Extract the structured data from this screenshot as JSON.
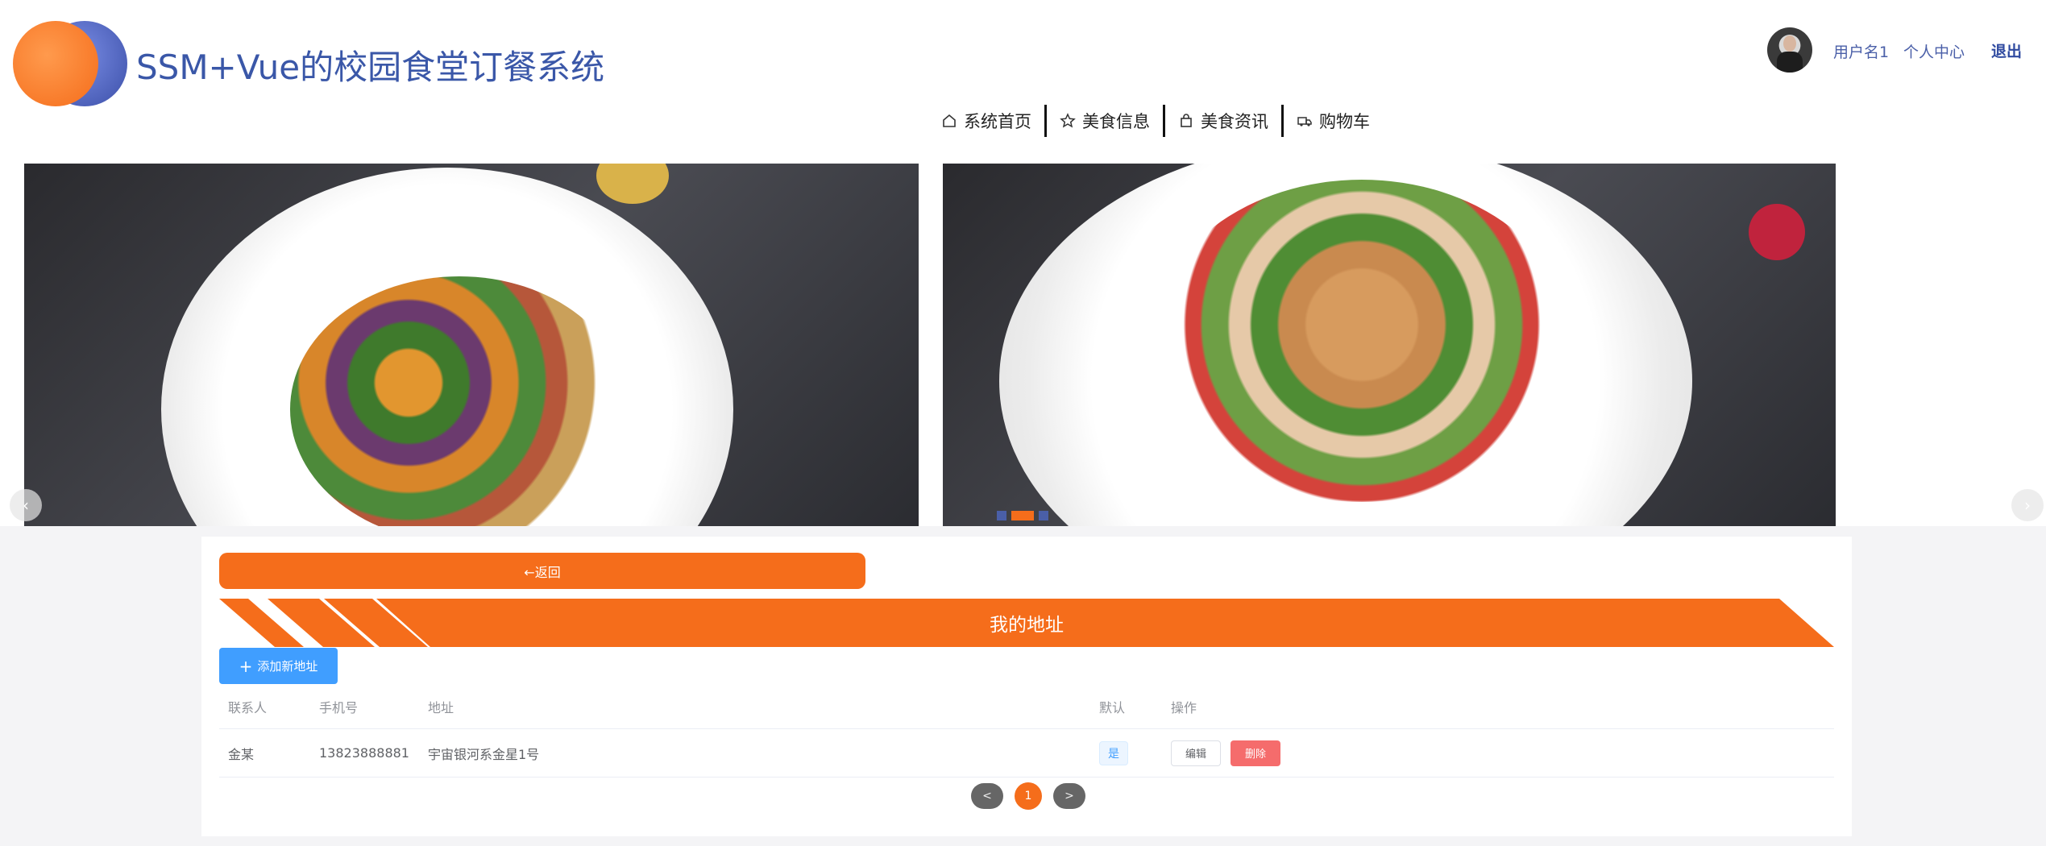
{
  "header": {
    "title": "SSM+Vue的校园食堂订餐系统",
    "username": "用户名1",
    "profile_label": "个人中心",
    "logout_label": "退出"
  },
  "nav": {
    "items": [
      {
        "label": "系统首页",
        "icon": "home-icon"
      },
      {
        "label": "美食信息",
        "icon": "star-icon"
      },
      {
        "label": "美食资讯",
        "icon": "bag-icon"
      },
      {
        "label": "购物车",
        "icon": "truck-icon"
      }
    ]
  },
  "banner": {
    "prev_arrow": "‹",
    "next_arrow": "›",
    "slide_count": 3,
    "active_slide": 2
  },
  "page": {
    "back_label": "←返回",
    "section_title": "我的地址",
    "add_label": "添加新地址"
  },
  "table": {
    "headers": [
      "联系人",
      "手机号",
      "地址",
      "默认",
      "操作"
    ],
    "rows": [
      {
        "name": "金某",
        "phone": "13823888881",
        "address": "宇宙银河系金星1号",
        "default": "是",
        "edit": "编辑",
        "delete": "删除"
      }
    ]
  },
  "pagination": {
    "prev": "<",
    "current": "1",
    "next": ">"
  },
  "colors": {
    "accent": "#f56d1b",
    "brand_blue": "#3a57a8",
    "primary_button": "#409eff",
    "danger": "#f56c6c"
  }
}
